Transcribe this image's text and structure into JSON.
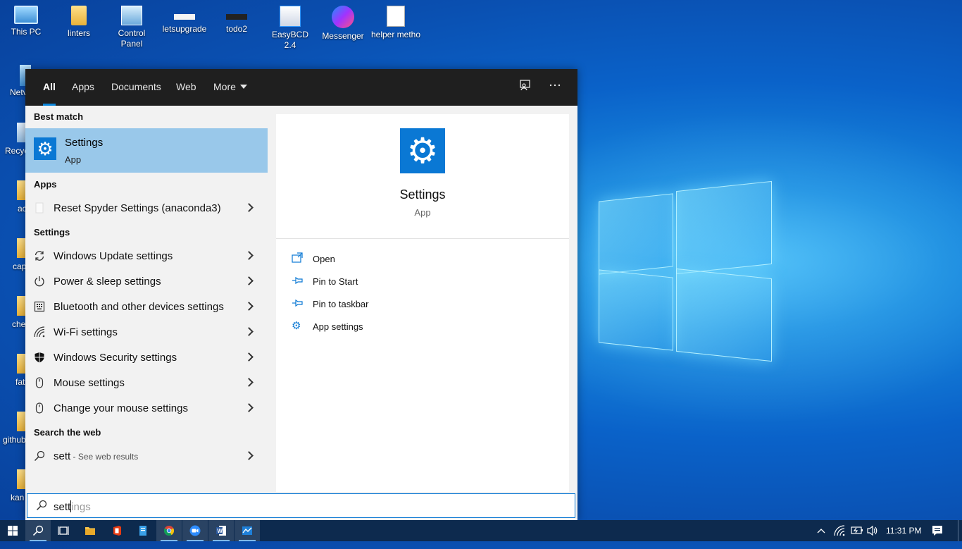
{
  "desktop": {
    "icons": [
      {
        "label": "This PC",
        "icon": "computer-icon"
      },
      {
        "label": "linters",
        "icon": "folder-icon"
      },
      {
        "label": "Control Panel",
        "icon": "control-panel-icon"
      },
      {
        "label": "letsupgrade",
        "icon": "file-bar-icon"
      },
      {
        "label": "todo2",
        "icon": "file-bar-icon"
      },
      {
        "label": "EasyBCD 2.4",
        "icon": "easybcd-icon"
      },
      {
        "label": "Messenger",
        "icon": "messenger-icon"
      },
      {
        "label": "helper metho",
        "icon": "document-icon"
      }
    ],
    "edge_labels": [
      "Netv",
      "Recyc",
      "ac",
      "cap",
      "che",
      "fat",
      "github",
      "kan"
    ]
  },
  "search": {
    "tabs": [
      "All",
      "Apps",
      "Documents",
      "Web",
      "More"
    ],
    "active_tab": "All",
    "best_match_header": "Best match",
    "best_match": {
      "title": "Settings",
      "type": "App",
      "icon": "gear-icon"
    },
    "apps_header": "Apps",
    "apps": [
      {
        "label": "Reset Spyder Settings (anaconda3)",
        "icon": "blank-file-icon"
      }
    ],
    "settings_header": "Settings",
    "settings": [
      {
        "label": "Windows Update settings",
        "icon": "refresh-icon"
      },
      {
        "label": "Power & sleep settings",
        "icon": "power-icon"
      },
      {
        "label": "Bluetooth and other devices settings",
        "icon": "keyboard-icon"
      },
      {
        "label": "Wi-Fi settings",
        "icon": "wifi-icon"
      },
      {
        "label": "Windows Security settings",
        "icon": "shield-icon"
      },
      {
        "label": "Mouse settings",
        "icon": "mouse-icon"
      },
      {
        "label": "Change your mouse settings",
        "icon": "mouse-icon"
      }
    ],
    "web_header": "Search the web",
    "web": {
      "query": "sett",
      "suffix": " - See web results",
      "icon": "search-icon"
    },
    "preview": {
      "title": "Settings",
      "type": "App",
      "actions": [
        {
          "label": "Open",
          "icon": "open-icon"
        },
        {
          "label": "Pin to Start",
          "icon": "pin-icon"
        },
        {
          "label": "Pin to taskbar",
          "icon": "pin-icon"
        },
        {
          "label": "App settings",
          "icon": "gear-icon"
        }
      ]
    },
    "box": {
      "typed": "sett",
      "ghost": "ings"
    }
  },
  "taskbar": {
    "time": "11:31 PM",
    "apps": [
      "start-icon",
      "search-icon",
      "task-view-icon",
      "file-explorer-icon",
      "office-icon",
      "file-icon",
      "chrome-icon",
      "zoom-icon",
      "word-icon",
      "app-icon"
    ]
  },
  "colors": {
    "accent": "#0a78d4",
    "topbar": "#1f1f1f",
    "selected": "#99c8ea",
    "taskbar": "#0d2a4e"
  }
}
